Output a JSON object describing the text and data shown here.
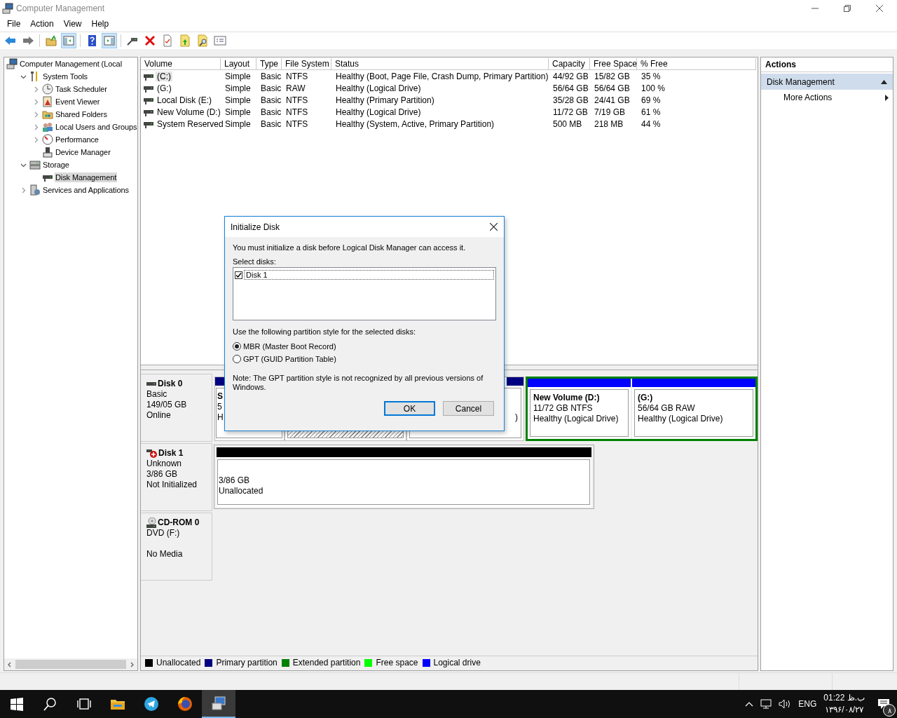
{
  "window": {
    "title": "Computer Management"
  },
  "menu": [
    "File",
    "Action",
    "View",
    "Help"
  ],
  "toolbar": [
    {
      "kind": "back",
      "pressed": false
    },
    {
      "kind": "forward",
      "pressed": false
    },
    {
      "kind": "up",
      "pressed": false
    },
    {
      "kind": "tree",
      "pressed": true
    },
    {
      "kind": "help",
      "pressed": false
    },
    {
      "kind": "pane",
      "pressed": true
    },
    {
      "kind": "connect",
      "pressed": false
    },
    {
      "kind": "delete",
      "pressed": false
    },
    {
      "kind": "check",
      "pressed": false
    },
    {
      "kind": "arrowup",
      "pressed": false
    },
    {
      "kind": "find",
      "pressed": false
    },
    {
      "kind": "list",
      "pressed": false
    }
  ],
  "tree": [
    {
      "label": "Computer Management (Local",
      "kind": "computer",
      "selected": false,
      "children": [
        {
          "label": "System Tools",
          "kind": "tools",
          "selected": false,
          "expanded": true,
          "children": [
            {
              "label": "Task Scheduler",
              "kind": "clock",
              "selected": false,
              "expanded": false
            },
            {
              "label": "Event Viewer",
              "kind": "log",
              "selected": false,
              "expanded": false
            },
            {
              "label": "Shared Folders",
              "kind": "folder",
              "selected": false,
              "expanded": false
            },
            {
              "label": "Local Users and Groups",
              "kind": "users",
              "selected": false,
              "expanded": false
            },
            {
              "label": "Performance",
              "kind": "gauge",
              "selected": false,
              "expanded": false
            },
            {
              "label": "Device Manager",
              "kind": "device",
              "selected": false
            }
          ]
        },
        {
          "label": "Storage",
          "kind": "storage",
          "selected": false,
          "expanded": true,
          "children": [
            {
              "label": "Disk Management",
              "kind": "disk",
              "selected": true
            }
          ]
        },
        {
          "label": "Services and Applications",
          "kind": "services",
          "selected": false,
          "expanded": false
        }
      ]
    }
  ],
  "volumes": {
    "columns": [
      "Volume",
      "Layout",
      "Type",
      "File System",
      "Status",
      "Capacity",
      "Free Space",
      "% Free"
    ],
    "rows": [
      {
        "selected": true,
        "cells": [
          " (C:)",
          "Simple",
          "Basic",
          "NTFS",
          "Healthy (Boot, Page File, Crash Dump, Primary Partition)",
          "44/92 GB",
          "15/82 GB",
          "35 %"
        ]
      },
      {
        "selected": false,
        "cells": [
          " (G:)",
          "Simple",
          "Basic",
          "RAW",
          "Healthy (Logical Drive)",
          "56/64 GB",
          "56/64 GB",
          "100 %"
        ]
      },
      {
        "selected": false,
        "cells": [
          "Local Disk (E:)",
          "Simple",
          "Basic",
          "NTFS",
          "Healthy (Primary Partition)",
          "35/28 GB",
          "24/41 GB",
          "69 %"
        ]
      },
      {
        "selected": false,
        "cells": [
          "New Volume (D:)",
          "Simple",
          "Basic",
          "NTFS",
          "Healthy (Logical Drive)",
          "11/72 GB",
          "7/19 GB",
          "61 %"
        ]
      },
      {
        "selected": false,
        "cells": [
          "System Reserved",
          "Simple",
          "Basic",
          "NTFS",
          "Healthy (System, Active, Primary Partition)",
          "500 MB",
          "218 MB",
          "44 %"
        ]
      }
    ]
  },
  "disks": [
    {
      "kind": "disk",
      "name": "Disk 0",
      "error": false,
      "lines": [
        "Basic",
        "149/05 GB",
        "Online"
      ],
      "partitions": [
        {
          "kind": "primary",
          "selected": false,
          "title": "S",
          "lines": [
            "5",
            "H"
          ]
        },
        {
          "kind": "primary",
          "selected": true
        },
        {
          "kind": "primary",
          "selected": false,
          "lines": [
            ")"
          ]
        },
        {
          "kind": "extended",
          "children": [
            {
              "kind": "logical",
              "selected": false,
              "title": "New Volume  (D:)",
              "lines": [
                "11/72 GB NTFS",
                "Healthy (Logical Drive)"
              ]
            },
            {
              "kind": "logical",
              "selected": false,
              "title": "(G:)",
              "lines": [
                "56/64 GB RAW",
                "Healthy (Logical Drive)"
              ]
            }
          ]
        }
      ]
    },
    {
      "kind": "disk",
      "name": "Disk 1",
      "error": true,
      "lines": [
        "Unknown",
        "3/86 GB",
        "Not Initialized"
      ],
      "partitions": [
        {
          "kind": "unallocated",
          "selected": false,
          "lines": [
            "3/86 GB",
            "Unallocated"
          ]
        }
      ]
    },
    {
      "kind": "cdrom",
      "name": "CD-ROM 0",
      "lines": [
        "DVD (F:)"
      ],
      "media": "No Media"
    }
  ],
  "legend": [
    {
      "label": "Unallocated",
      "color": "#000000"
    },
    {
      "label": "Primary partition",
      "color": "#000080"
    },
    {
      "label": "Extended partition",
      "color": "#008000"
    },
    {
      "label": "Free space",
      "color": "#00ff00"
    },
    {
      "label": "Logical drive",
      "color": "#0000ff"
    }
  ],
  "actions": {
    "title": "Actions",
    "sections": [
      {
        "label": "Disk Management",
        "items": [
          {
            "label": "More Actions"
          }
        ]
      }
    ]
  },
  "dialog": {
    "title": "Initialize Disk",
    "message": "You must initialize a disk before Logical Disk Manager can access it.",
    "select_label": "Select disks:",
    "disks": [
      {
        "label": "Disk 1",
        "checked": true,
        "selected": true
      }
    ],
    "style_label": "Use the following partition style for the selected disks:",
    "styles": [
      {
        "label": "MBR (Master Boot Record)",
        "selected": true
      },
      {
        "label": "GPT (GUID Partition Table)",
        "selected": false
      }
    ],
    "note": "Note: The GPT partition style is not recognized by all previous versions of Windows.",
    "buttons": [
      {
        "label": "OK",
        "default": true
      },
      {
        "label": "Cancel",
        "default": false
      }
    ]
  },
  "taskbar": {
    "items": [
      {
        "kind": "start",
        "active": false
      },
      {
        "kind": "search",
        "active": false
      },
      {
        "kind": "taskview",
        "active": false
      },
      {
        "kind": "explorer",
        "active": false
      },
      {
        "kind": "telegram",
        "active": false
      },
      {
        "kind": "firefox",
        "active": false
      },
      {
        "kind": "mmc",
        "active": true
      }
    ],
    "language": "ENG",
    "time": "01:22 ب.ظ",
    "date": "۱۳۹۶/۰۸/۲۷",
    "notifications": "۸"
  }
}
